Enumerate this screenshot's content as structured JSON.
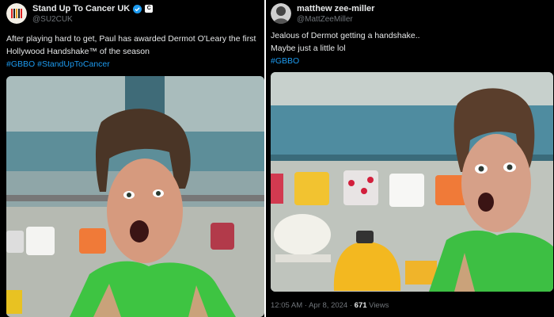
{
  "left_post": {
    "display_name": "Stand Up To Cancer UK",
    "handle": "@SU2CUK",
    "affiliate_badge": "C",
    "text": "After playing hard to get, Paul has awarded Dermot O'Leary the first Hollywood Handshake™ of the season",
    "hashtags": [
      "#GBBO",
      "#StandUpToCancer"
    ]
  },
  "right_post": {
    "display_name": "matthew zee-miller",
    "handle": "@MattZeeMiller",
    "text_line1": "Jealous of Dermot getting a handshake..",
    "text_line2": "Maybe just a little lol",
    "hashtag": "#GBBO",
    "time": "12:05 AM",
    "date": "Apr 8, 2024",
    "views_count": "671",
    "views_label": "Views"
  },
  "colors": {
    "background": "#000000",
    "text": "#e7e9ea",
    "secondary": "#71767b",
    "link": "#1d9bf0",
    "verified": "#1d9bf0"
  }
}
